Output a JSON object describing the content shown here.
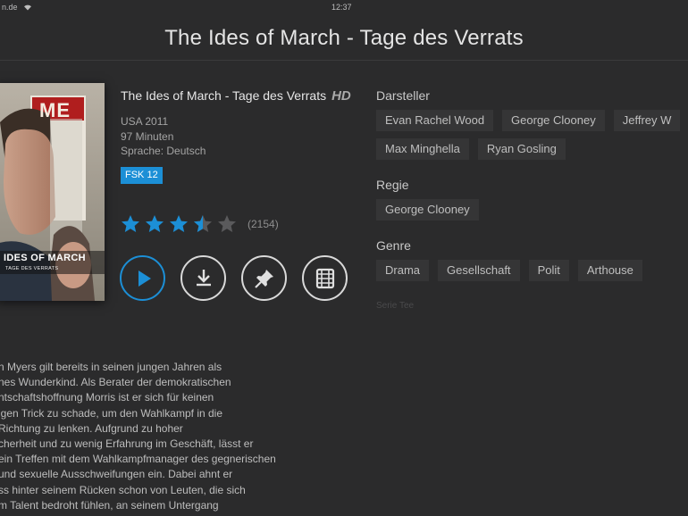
{
  "status_bar": {
    "carrier": "n.de",
    "time": "12:37"
  },
  "header": {
    "title": "The Ides of March - Tage des Verrats"
  },
  "poster": {
    "headline": "IDES OF MARCH",
    "subline": "TAGE DES VERRATS",
    "magazine_letters": "ME"
  },
  "movie": {
    "title": "The Ides of March - Tage des Verrats",
    "hd": "HD",
    "country_year": "USA 2011",
    "duration": "97 Minuten",
    "language": "Sprache: Deutsch",
    "fsk": "FSK 12",
    "rating": 3.5,
    "rating_count": "(2154)"
  },
  "actions": {
    "play": "play-icon",
    "download": "download-icon",
    "pin": "pin-icon",
    "trailer": "film-icon"
  },
  "cast": {
    "label": "Darsteller",
    "names": [
      "Evan Rachel Wood",
      "George Clooney",
      "Jeffrey W",
      "Max Minghella",
      "Ryan Gosling"
    ]
  },
  "director": {
    "label": "Regie",
    "names": [
      "George Clooney"
    ]
  },
  "genre": {
    "label": "Genre",
    "items": [
      "Drama",
      "Gesellschaft",
      "Polit",
      "Arthouse"
    ]
  },
  "muted_label": "Serie Tee",
  "description": {
    "lines": [
      "n Myers gilt bereits in seinen jungen Jahren als",
      "nes Wunderkind. Als Berater der demokratischen",
      "ntschaftshoffnung Morris ist er sich für keinen",
      "igen Trick zu schade, um den Wahlkampf in die",
      "Richtung zu lenken. Aufgrund zu hoher",
      "cherheit und zu wenig Erfahrung im Geschäft, lässt er",
      "ein Treffen mit dem Wahlkampfmanager des gegnerischen",
      "und sexuelle Ausschweifungen ein. Dabei ahnt er",
      "ss hinter seinem Rücken schon von Leuten, die sich",
      "m Talent bedroht fühlen, an seinem Untergang"
    ]
  },
  "colors": {
    "accent": "#1c8fd6",
    "background": "#2b2b2c",
    "chip": "#353536"
  }
}
